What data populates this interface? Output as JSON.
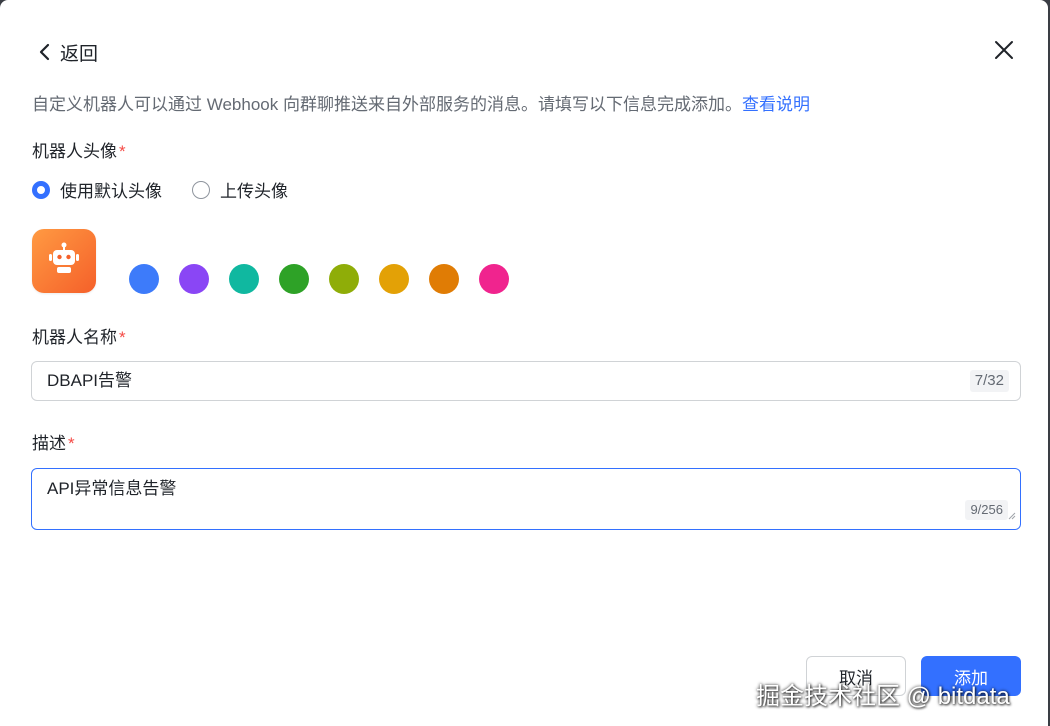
{
  "header": {
    "back_label": "返回"
  },
  "intro": {
    "text": "自定义机器人可以通过 Webhook 向群聊推送来自外部服务的消息。请填写以下信息完成添加。",
    "link": "查看说明"
  },
  "avatar_section": {
    "label": "机器人头像",
    "required_mark": "*",
    "options": [
      {
        "label": "使用默认头像",
        "selected": true
      },
      {
        "label": "上传头像",
        "selected": false
      }
    ],
    "preview_icon": "robot-icon",
    "preview_color": "#f77234",
    "colors": [
      "#3d7bfa",
      "#8a46f5",
      "#10b8a0",
      "#2ea227",
      "#8fad08",
      "#e3a106",
      "#e07c05",
      "#f0248e"
    ]
  },
  "name_section": {
    "label": "机器人名称",
    "required_mark": "*",
    "value": "DBAPI告警",
    "counter": "7/32"
  },
  "desc_section": {
    "label": "描述",
    "required_mark": "*",
    "value": "API异常信息告警",
    "counter": "9/256"
  },
  "footer": {
    "cancel_label": "取消",
    "add_label": "添加"
  },
  "watermark": "掘金技术社区 @ bitdata",
  "colors": {
    "primary": "#3370ff",
    "required": "#f54a45",
    "text": "#1f2329",
    "muted": "#646a73"
  }
}
